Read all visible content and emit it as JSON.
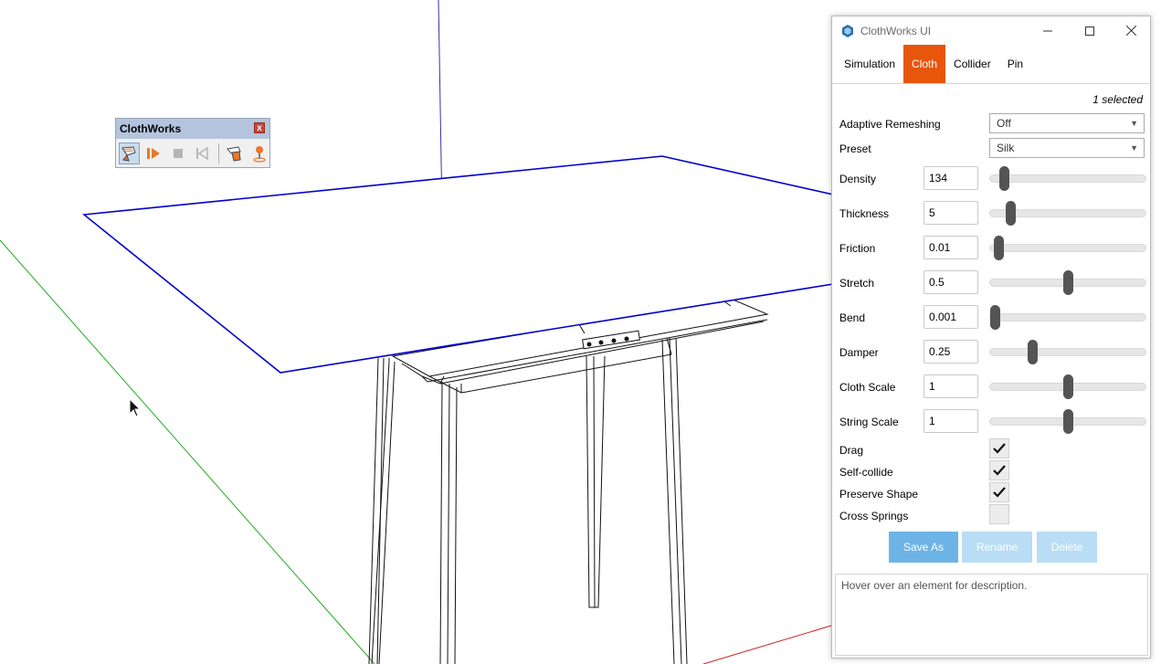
{
  "toolbar": {
    "title": "ClothWorks",
    "close_label": "x",
    "icons": [
      "cloth-tool-icon",
      "play-icon",
      "stop-icon",
      "reset-icon",
      "collider-icon",
      "pin-icon"
    ]
  },
  "window": {
    "title": "ClothWorks UI",
    "tabs": [
      {
        "label": "Simulation",
        "active": false
      },
      {
        "label": "Cloth",
        "active": true
      },
      {
        "label": "Collider",
        "active": false
      },
      {
        "label": "Pin",
        "active": false
      }
    ],
    "selected_info": "1 selected",
    "adaptive_remeshing": {
      "label": "Adaptive Remeshing",
      "value": "Off"
    },
    "preset": {
      "label": "Preset",
      "value": "Silk"
    },
    "params": [
      {
        "label": "Density",
        "value": "134",
        "slider": 0.09
      },
      {
        "label": "Thickness",
        "value": "5",
        "slider": 0.13
      },
      {
        "label": "Friction",
        "value": "0.01",
        "slider": 0.05
      },
      {
        "label": "Stretch",
        "value": "0.5",
        "slider": 0.5
      },
      {
        "label": "Bend",
        "value": "0.001",
        "slider": 0.03
      },
      {
        "label": "Damper",
        "value": "0.25",
        "slider": 0.27
      },
      {
        "label": "Cloth Scale",
        "value": "1",
        "slider": 0.5
      },
      {
        "label": "String Scale",
        "value": "1",
        "slider": 0.5
      }
    ],
    "checkboxes": [
      {
        "label": "Drag",
        "checked": true
      },
      {
        "label": "Self-collide",
        "checked": true
      },
      {
        "label": "Preserve Shape",
        "checked": true
      },
      {
        "label": "Cross Springs",
        "checked": false
      }
    ],
    "buttons": {
      "save_as": "Save As",
      "rename": "Rename",
      "delete": "Delete"
    },
    "description": "Hover over an element for description."
  },
  "colors": {
    "accent": "#e8560c",
    "button_active": "#6db4e6",
    "button_disabled": "#b9ddf4",
    "edge_selected": "#0000d0",
    "axis_green": "#22aa22",
    "axis_red": "#cc2222",
    "axis_blue": "#3333aa"
  }
}
